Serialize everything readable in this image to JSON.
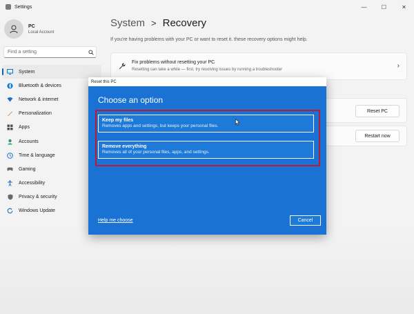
{
  "window": {
    "title": "Settings",
    "controls": {
      "minimize": "—",
      "maximize": "☐",
      "close": "✕"
    }
  },
  "profile": {
    "name": "PC",
    "account": "Local Account"
  },
  "search": {
    "placeholder": "Find a setting",
    "icon": "search-icon"
  },
  "nav": [
    {
      "label": "System",
      "icon": "system-icon",
      "active": true,
      "color": "#0078d4"
    },
    {
      "label": "Bluetooth & devices",
      "icon": "bluetooth-icon",
      "color": "#0078d4"
    },
    {
      "label": "Network & internet",
      "icon": "wifi-icon",
      "color": "#1b6ec2"
    },
    {
      "label": "Personalization",
      "icon": "brush-icon",
      "color": "#d16c2b"
    },
    {
      "label": "Apps",
      "icon": "apps-icon",
      "color": "#505050"
    },
    {
      "label": "Accounts",
      "icon": "accounts-icon",
      "color": "#2a9d6a"
    },
    {
      "label": "Time & language",
      "icon": "clock-globe-icon",
      "color": "#1b6ec2"
    },
    {
      "label": "Gaming",
      "icon": "gamepad-icon",
      "color": "#6a6a6a"
    },
    {
      "label": "Accessibility",
      "icon": "accessibility-icon",
      "color": "#1b6ec2"
    },
    {
      "label": "Privacy & security",
      "icon": "shield-icon",
      "color": "#6a6a6a"
    },
    {
      "label": "Windows Update",
      "icon": "update-icon",
      "color": "#1b6ec2"
    }
  ],
  "breadcrumb": {
    "parent": "System",
    "separator": ">",
    "current": "Recovery"
  },
  "subtitle": "If you're having problems with your PC or want to reset it. these recovery options might help.",
  "cards": {
    "fix": {
      "title": "Fix problems without resetting your PC",
      "subtitle": "Resetting can take a while — first, try resolving issues by running a troubleshooter",
      "icon": "wrench-icon",
      "chevron": "›"
    },
    "reset": {
      "button": "Reset PC"
    },
    "restart": {
      "button": "Restart now"
    }
  },
  "dialog": {
    "title": "Reset this PC",
    "heading": "Choose an option",
    "options": [
      {
        "title": "Keep my files",
        "subtitle": "Removes apps and settings, but keeps your personal files."
      },
      {
        "title": "Remove everything",
        "subtitle": "Removes all of your personal files, apps, and settings."
      }
    ],
    "help_link": "Help me choose",
    "cancel": "Cancel",
    "colors": {
      "background": "#1a73d4",
      "highlight": "#c0182e"
    }
  }
}
